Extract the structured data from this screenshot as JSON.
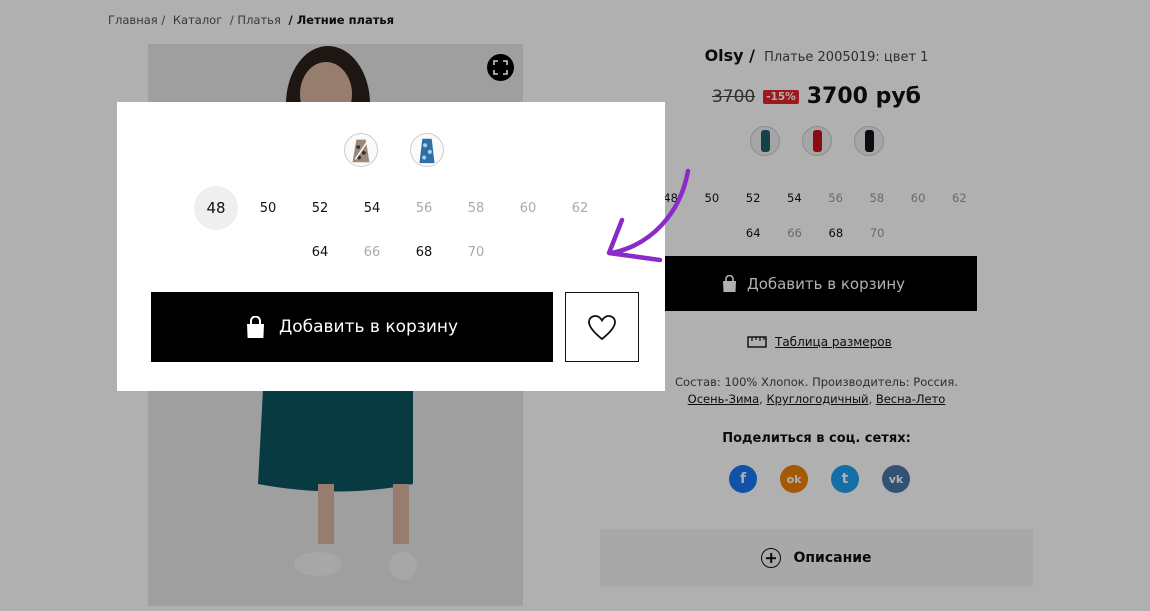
{
  "breadcrumb": {
    "items": [
      "Главная /",
      "Каталог",
      "/ Платья",
      "/"
    ],
    "current": "Летние платья"
  },
  "product": {
    "brand": "Olsy /",
    "model": "Платье 2005019: цвет 1",
    "old_price": "3700",
    "discount": "-15%",
    "new_price": "3700 руб"
  },
  "colors": [
    "#1f5f68",
    "#c8141e",
    "#10141c"
  ],
  "sizes_row1": [
    {
      "label": "48",
      "available": true
    },
    {
      "label": "50",
      "available": true
    },
    {
      "label": "52",
      "available": true
    },
    {
      "label": "54",
      "available": true
    },
    {
      "label": "56",
      "available": false
    },
    {
      "label": "58",
      "available": false
    },
    {
      "label": "60",
      "available": false
    },
    {
      "label": "62",
      "available": false
    }
  ],
  "sizes_row2": [
    {
      "label": "64",
      "available": true
    },
    {
      "label": "66",
      "available": false
    },
    {
      "label": "68",
      "available": true
    },
    {
      "label": "70",
      "available": false
    }
  ],
  "selected_size": "48",
  "cart_label": "Добавить в корзину",
  "size_table_label": "Таблица размеров",
  "composition": "Состав: 100% Хлопок. Производитель: Россия.",
  "seasons": [
    "Осень-Зима",
    "Круглогодичный",
    "Весна-Лето"
  ],
  "share_title": "Поделиться в соц. сетях:",
  "socials": [
    {
      "name": "facebook",
      "letter": "f",
      "color": "#1877f2"
    },
    {
      "name": "odnoklassniki",
      "letter": "ok",
      "color": "#ee8208"
    },
    {
      "name": "twitter",
      "letter": "t",
      "color": "#1da1f2"
    },
    {
      "name": "vk",
      "letter": "vk",
      "color": "#4a76a8"
    }
  ],
  "description_label": "Описание",
  "accent_arrow_color": "#8a2bc9"
}
